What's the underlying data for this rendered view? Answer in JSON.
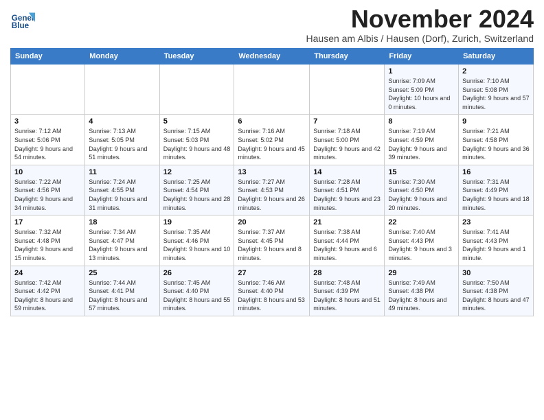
{
  "logo": {
    "name": "General",
    "name2": "Blue"
  },
  "title": "November 2024",
  "subtitle": "Hausen am Albis / Hausen (Dorf), Zurich, Switzerland",
  "days_of_week": [
    "Sunday",
    "Monday",
    "Tuesday",
    "Wednesday",
    "Thursday",
    "Friday",
    "Saturday"
  ],
  "weeks": [
    [
      {
        "day": "",
        "info": ""
      },
      {
        "day": "",
        "info": ""
      },
      {
        "day": "",
        "info": ""
      },
      {
        "day": "",
        "info": ""
      },
      {
        "day": "",
        "info": ""
      },
      {
        "day": "1",
        "info": "Sunrise: 7:09 AM\nSunset: 5:09 PM\nDaylight: 10 hours and 0 minutes."
      },
      {
        "day": "2",
        "info": "Sunrise: 7:10 AM\nSunset: 5:08 PM\nDaylight: 9 hours and 57 minutes."
      }
    ],
    [
      {
        "day": "3",
        "info": "Sunrise: 7:12 AM\nSunset: 5:06 PM\nDaylight: 9 hours and 54 minutes."
      },
      {
        "day": "4",
        "info": "Sunrise: 7:13 AM\nSunset: 5:05 PM\nDaylight: 9 hours and 51 minutes."
      },
      {
        "day": "5",
        "info": "Sunrise: 7:15 AM\nSunset: 5:03 PM\nDaylight: 9 hours and 48 minutes."
      },
      {
        "day": "6",
        "info": "Sunrise: 7:16 AM\nSunset: 5:02 PM\nDaylight: 9 hours and 45 minutes."
      },
      {
        "day": "7",
        "info": "Sunrise: 7:18 AM\nSunset: 5:00 PM\nDaylight: 9 hours and 42 minutes."
      },
      {
        "day": "8",
        "info": "Sunrise: 7:19 AM\nSunset: 4:59 PM\nDaylight: 9 hours and 39 minutes."
      },
      {
        "day": "9",
        "info": "Sunrise: 7:21 AM\nSunset: 4:58 PM\nDaylight: 9 hours and 36 minutes."
      }
    ],
    [
      {
        "day": "10",
        "info": "Sunrise: 7:22 AM\nSunset: 4:56 PM\nDaylight: 9 hours and 34 minutes."
      },
      {
        "day": "11",
        "info": "Sunrise: 7:24 AM\nSunset: 4:55 PM\nDaylight: 9 hours and 31 minutes."
      },
      {
        "day": "12",
        "info": "Sunrise: 7:25 AM\nSunset: 4:54 PM\nDaylight: 9 hours and 28 minutes."
      },
      {
        "day": "13",
        "info": "Sunrise: 7:27 AM\nSunset: 4:53 PM\nDaylight: 9 hours and 26 minutes."
      },
      {
        "day": "14",
        "info": "Sunrise: 7:28 AM\nSunset: 4:51 PM\nDaylight: 9 hours and 23 minutes."
      },
      {
        "day": "15",
        "info": "Sunrise: 7:30 AM\nSunset: 4:50 PM\nDaylight: 9 hours and 20 minutes."
      },
      {
        "day": "16",
        "info": "Sunrise: 7:31 AM\nSunset: 4:49 PM\nDaylight: 9 hours and 18 minutes."
      }
    ],
    [
      {
        "day": "17",
        "info": "Sunrise: 7:32 AM\nSunset: 4:48 PM\nDaylight: 9 hours and 15 minutes."
      },
      {
        "day": "18",
        "info": "Sunrise: 7:34 AM\nSunset: 4:47 PM\nDaylight: 9 hours and 13 minutes."
      },
      {
        "day": "19",
        "info": "Sunrise: 7:35 AM\nSunset: 4:46 PM\nDaylight: 9 hours and 10 minutes."
      },
      {
        "day": "20",
        "info": "Sunrise: 7:37 AM\nSunset: 4:45 PM\nDaylight: 9 hours and 8 minutes."
      },
      {
        "day": "21",
        "info": "Sunrise: 7:38 AM\nSunset: 4:44 PM\nDaylight: 9 hours and 6 minutes."
      },
      {
        "day": "22",
        "info": "Sunrise: 7:40 AM\nSunset: 4:43 PM\nDaylight: 9 hours and 3 minutes."
      },
      {
        "day": "23",
        "info": "Sunrise: 7:41 AM\nSunset: 4:43 PM\nDaylight: 9 hours and 1 minute."
      }
    ],
    [
      {
        "day": "24",
        "info": "Sunrise: 7:42 AM\nSunset: 4:42 PM\nDaylight: 8 hours and 59 minutes."
      },
      {
        "day": "25",
        "info": "Sunrise: 7:44 AM\nSunset: 4:41 PM\nDaylight: 8 hours and 57 minutes."
      },
      {
        "day": "26",
        "info": "Sunrise: 7:45 AM\nSunset: 4:40 PM\nDaylight: 8 hours and 55 minutes."
      },
      {
        "day": "27",
        "info": "Sunrise: 7:46 AM\nSunset: 4:40 PM\nDaylight: 8 hours and 53 minutes."
      },
      {
        "day": "28",
        "info": "Sunrise: 7:48 AM\nSunset: 4:39 PM\nDaylight: 8 hours and 51 minutes."
      },
      {
        "day": "29",
        "info": "Sunrise: 7:49 AM\nSunset: 4:38 PM\nDaylight: 8 hours and 49 minutes."
      },
      {
        "day": "30",
        "info": "Sunrise: 7:50 AM\nSunset: 4:38 PM\nDaylight: 8 hours and 47 minutes."
      }
    ]
  ]
}
